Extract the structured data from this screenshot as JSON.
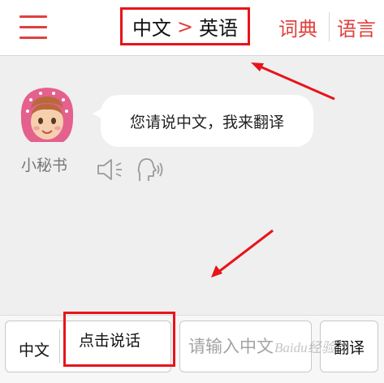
{
  "colors": {
    "accent": "#e0403d",
    "highlight": "#e8141a",
    "background": "#efefef"
  },
  "header": {
    "menu_icon": "hamburger-menu-icon",
    "source_lang": "中文",
    "separator": ">",
    "target_lang": "英语",
    "dict_label": "词典",
    "language_label": "语言"
  },
  "chat": {
    "assistant_name": "小秘书",
    "message": "您请说中文，我来翻译",
    "icons": [
      "speaker-icon",
      "speak-voice-icon"
    ]
  },
  "input_bar": {
    "lang_label": "中文",
    "talk_label": "点击说话",
    "text_placeholder": "请输入中文",
    "translate_label": "翻译"
  },
  "watermark": "Baidu经验"
}
